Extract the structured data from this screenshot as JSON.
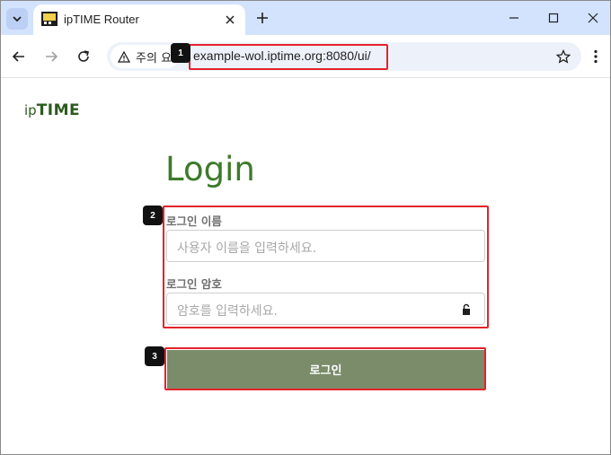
{
  "browser": {
    "tab_title": "ipTIME Router",
    "security_chip": "주의 요",
    "url": "example-wol.iptime.org:8080/ui/"
  },
  "page": {
    "logo_ip": "ip",
    "logo_time": "TIME",
    "title": "Login",
    "username_label": "로그인 이름",
    "username_placeholder": "사용자 이름을 입력하세요.",
    "password_label": "로그인 암호",
    "password_placeholder": "암호를 입력하세요.",
    "login_button": "로그인"
  },
  "annotations": {
    "badge_1": "1",
    "badge_2": "2",
    "badge_3": "3",
    "color": "#e3232b"
  },
  "colors": {
    "brand_green": "#3d7a2a",
    "button_green": "#7a8c6a"
  }
}
